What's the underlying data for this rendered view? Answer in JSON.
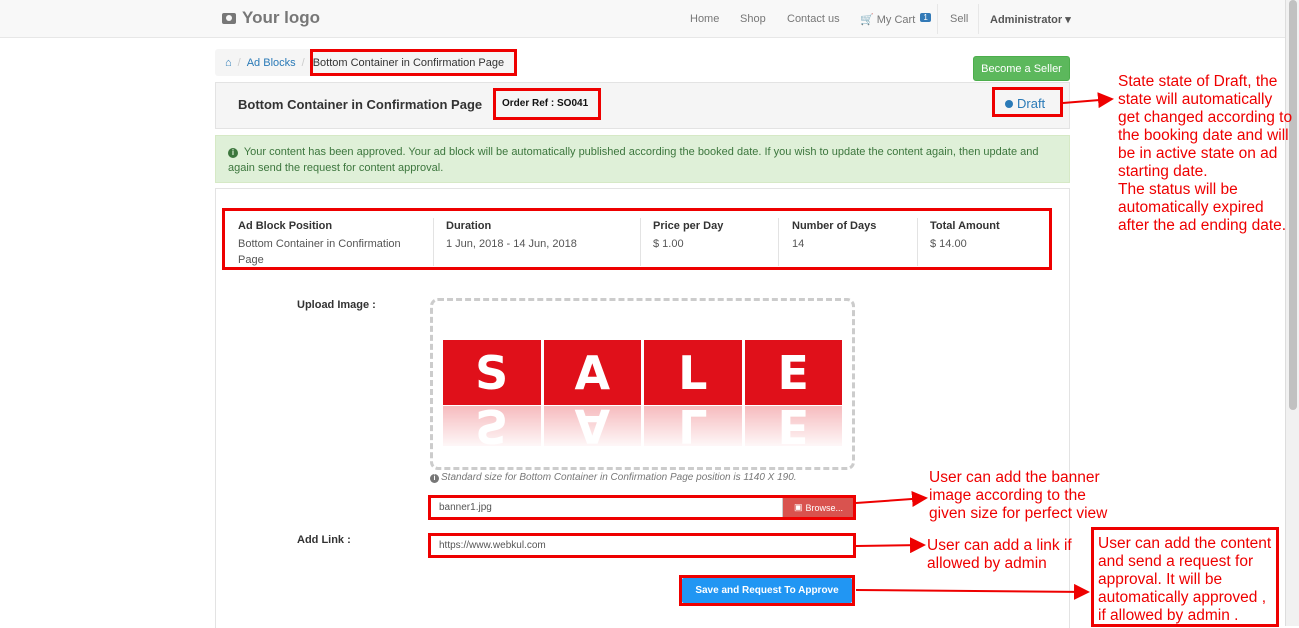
{
  "navbar": {
    "logo": "Your logo",
    "links": [
      "Home",
      "Shop",
      "Contact us"
    ],
    "cart_label": "My Cart",
    "cart_count": "1",
    "sell": "Sell",
    "user": "Administrator"
  },
  "breadcrumb": {
    "link": "Ad Blocks",
    "current": "Bottom Container in Confirmation Page"
  },
  "become_seller": "Become a Seller",
  "header": {
    "title": "Bottom Container in Confirmation Page",
    "order_ref": "Order Ref : SO041",
    "status": "Draft"
  },
  "alert": "Your content has been approved. Your ad block will be automatically published according the booked date. If you wish to update the content again, then update and again send the request for content approval.",
  "details": [
    {
      "label": "Ad Block Position",
      "value": "Bottom Container in Confirmation Page"
    },
    {
      "label": "Duration",
      "value": "1 Jun, 2018 - 14 Jun, 2018"
    },
    {
      "label": "Price per Day",
      "value": "$ 1.00"
    },
    {
      "label": "Number of Days",
      "value": "14"
    },
    {
      "label": "Total Amount",
      "value": "$ 14.00"
    }
  ],
  "form": {
    "upload_label": "Upload Image :",
    "banner_letters": [
      "S",
      "A",
      "L",
      "E"
    ],
    "hint": "Standard size for Bottom Container in Confirmation Page position is 1140 X 190.",
    "file_value": "banner1.jpg",
    "browse": "Browse...",
    "link_label": "Add Link :",
    "link_value": "https://www.webkul.com",
    "save": "Save and Request To Approve"
  },
  "notes": {
    "status": "State state of Draft, the state will automatically get changed according to the booking date and will be in active state on ad starting date.\nThe status will be automatically expired after the ad ending date.",
    "banner": "User can add the banner image according to the given size for perfect view",
    "link": "User can add a link if allowed by admin",
    "submit": "User can add the content and send a request for approval. It will be automatically approved , if allowed by admin ."
  },
  "colors": {
    "annotation": "#e00000",
    "link": "#2a7ab7",
    "success": "#5cb85c",
    "primary": "#2196f3",
    "danger": "#d9534f"
  }
}
